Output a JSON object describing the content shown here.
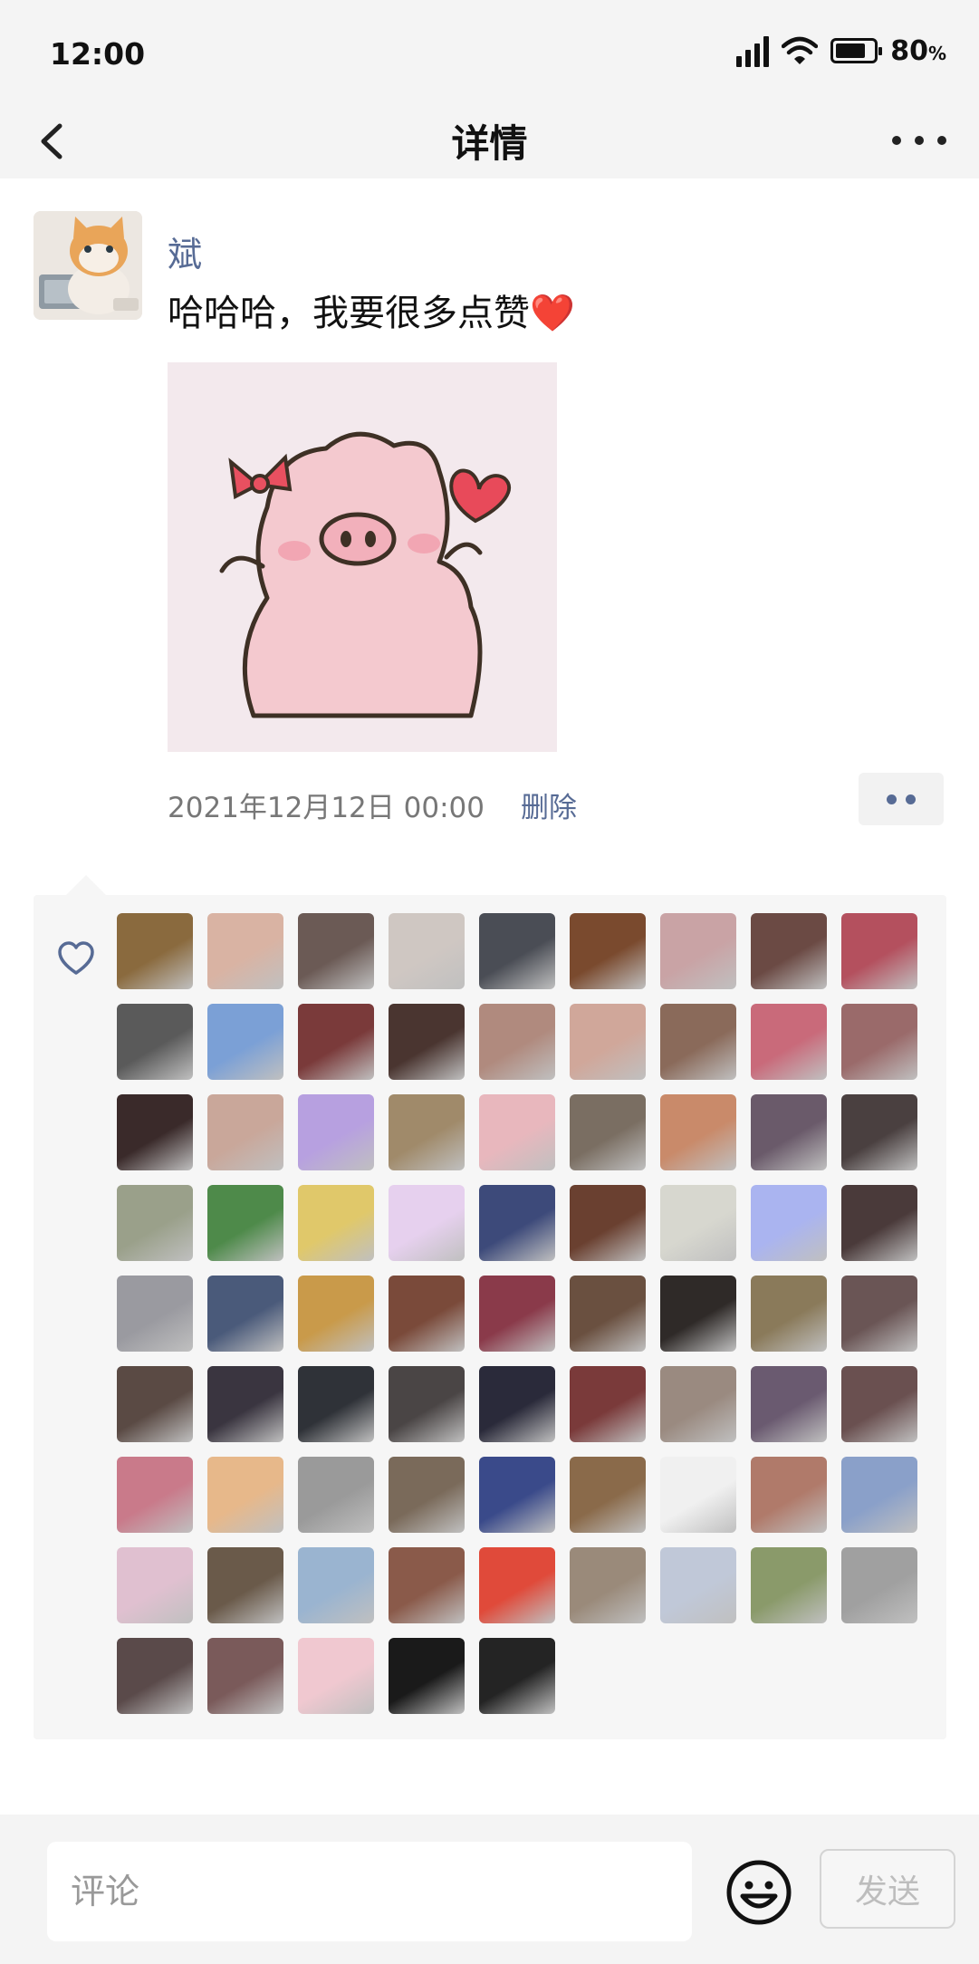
{
  "status_bar": {
    "time": "12:00",
    "battery_percent": 80,
    "battery_label": "80",
    "battery_unit": "%"
  },
  "nav": {
    "title": "详情",
    "back_icon": "chevron-left-icon",
    "more_icon": "more-horizontal-icon"
  },
  "post": {
    "username": "斌",
    "text": "哈哈哈，我要很多点赞❤️",
    "timestamp": "2021年12月12日 00:00",
    "delete_label": "删除",
    "action_icon": "comment-like-actions-icon"
  },
  "likes": {
    "icon": "heart-outline-icon",
    "count": 77,
    "avatar_colors": [
      "#8a6a3e",
      "#d9b3a3",
      "#6b5a55",
      "#cfc7c2",
      "#4a4d55",
      "#7a4a2e",
      "#c9a3a5",
      "#6b4a44",
      "#b4505e",
      "#5a5a5a",
      "#7ba0d6",
      "#7a3a3a",
      "#4a3530",
      "#b08a7e",
      "#d0a79a",
      "#8a6a5a",
      "#c96a7a",
      "#9a6a6a",
      "#3a2a2a",
      "#c9a79a",
      "#b7a0e0",
      "#a08a6a",
      "#e8b7bd",
      "#7a6e62",
      "#c98a6a",
      "#6a5a6a",
      "#4a4040",
      "#9aa08a",
      "#4e8a4a",
      "#e0c86a",
      "#e6d0ee",
      "#3d4a7a",
      "#6a4030",
      "#d7d7cf",
      "#aab4f0",
      "#4a3a3a",
      "#9a9aa0",
      "#4a5a7a",
      "#c99a4a",
      "#7a4a3a",
      "#8a3a4a",
      "#6a5040",
      "#2f2a28",
      "#8a7a5a",
      "#6a5555",
      "#5a4a44",
      "#3a3540",
      "#2f3238",
      "#4a4545",
      "#2a2a3a",
      "#7a3a3a",
      "#9a8a80",
      "#6a5a70",
      "#6a5050",
      "#c97a8a",
      "#e7b88a",
      "#9a9a9a",
      "#7a6a5a",
      "#3a4a8a",
      "#8a6a4a",
      "#f0f0f0",
      "#b07a6a",
      "#8aa0c9",
      "#e0c0d0",
      "#6a5a4a",
      "#9ab4d0",
      "#8a5a4a",
      "#e04a3a",
      "#9a8a7a",
      "#c0c8d8",
      "#8a9a6a",
      "#a0a0a0",
      "#5a4a4a",
      "#7a5a5a",
      "#f0c8d0",
      "#1a1a1a",
      "#242424"
    ]
  },
  "comment_bar": {
    "placeholder": "评论",
    "value": "",
    "emoji_icon": "emoji-smile-icon",
    "send_label": "发送"
  }
}
